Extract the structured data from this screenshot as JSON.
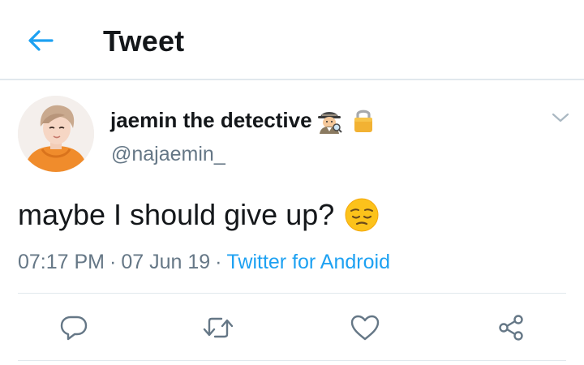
{
  "header": {
    "title": "Tweet",
    "back_icon": "arrow-left-icon"
  },
  "tweet": {
    "display_name": "jaemin the detective",
    "name_badges": [
      "detective-icon",
      "lock-icon"
    ],
    "handle": "@najaemin_",
    "text": "maybe I should give up?",
    "text_emoji": "pensive-face-icon",
    "time": "07:17 PM",
    "date": "07 Jun 19",
    "separator": "·",
    "source": "Twitter for Android"
  },
  "actions": [
    {
      "icon": "reply-icon"
    },
    {
      "icon": "retweet-icon"
    },
    {
      "icon": "like-icon"
    },
    {
      "icon": "share-icon"
    }
  ],
  "colors": {
    "accent": "#1da1f2",
    "text_primary": "#14171a",
    "text_secondary": "#657786",
    "divider": "#e1e8ed"
  }
}
